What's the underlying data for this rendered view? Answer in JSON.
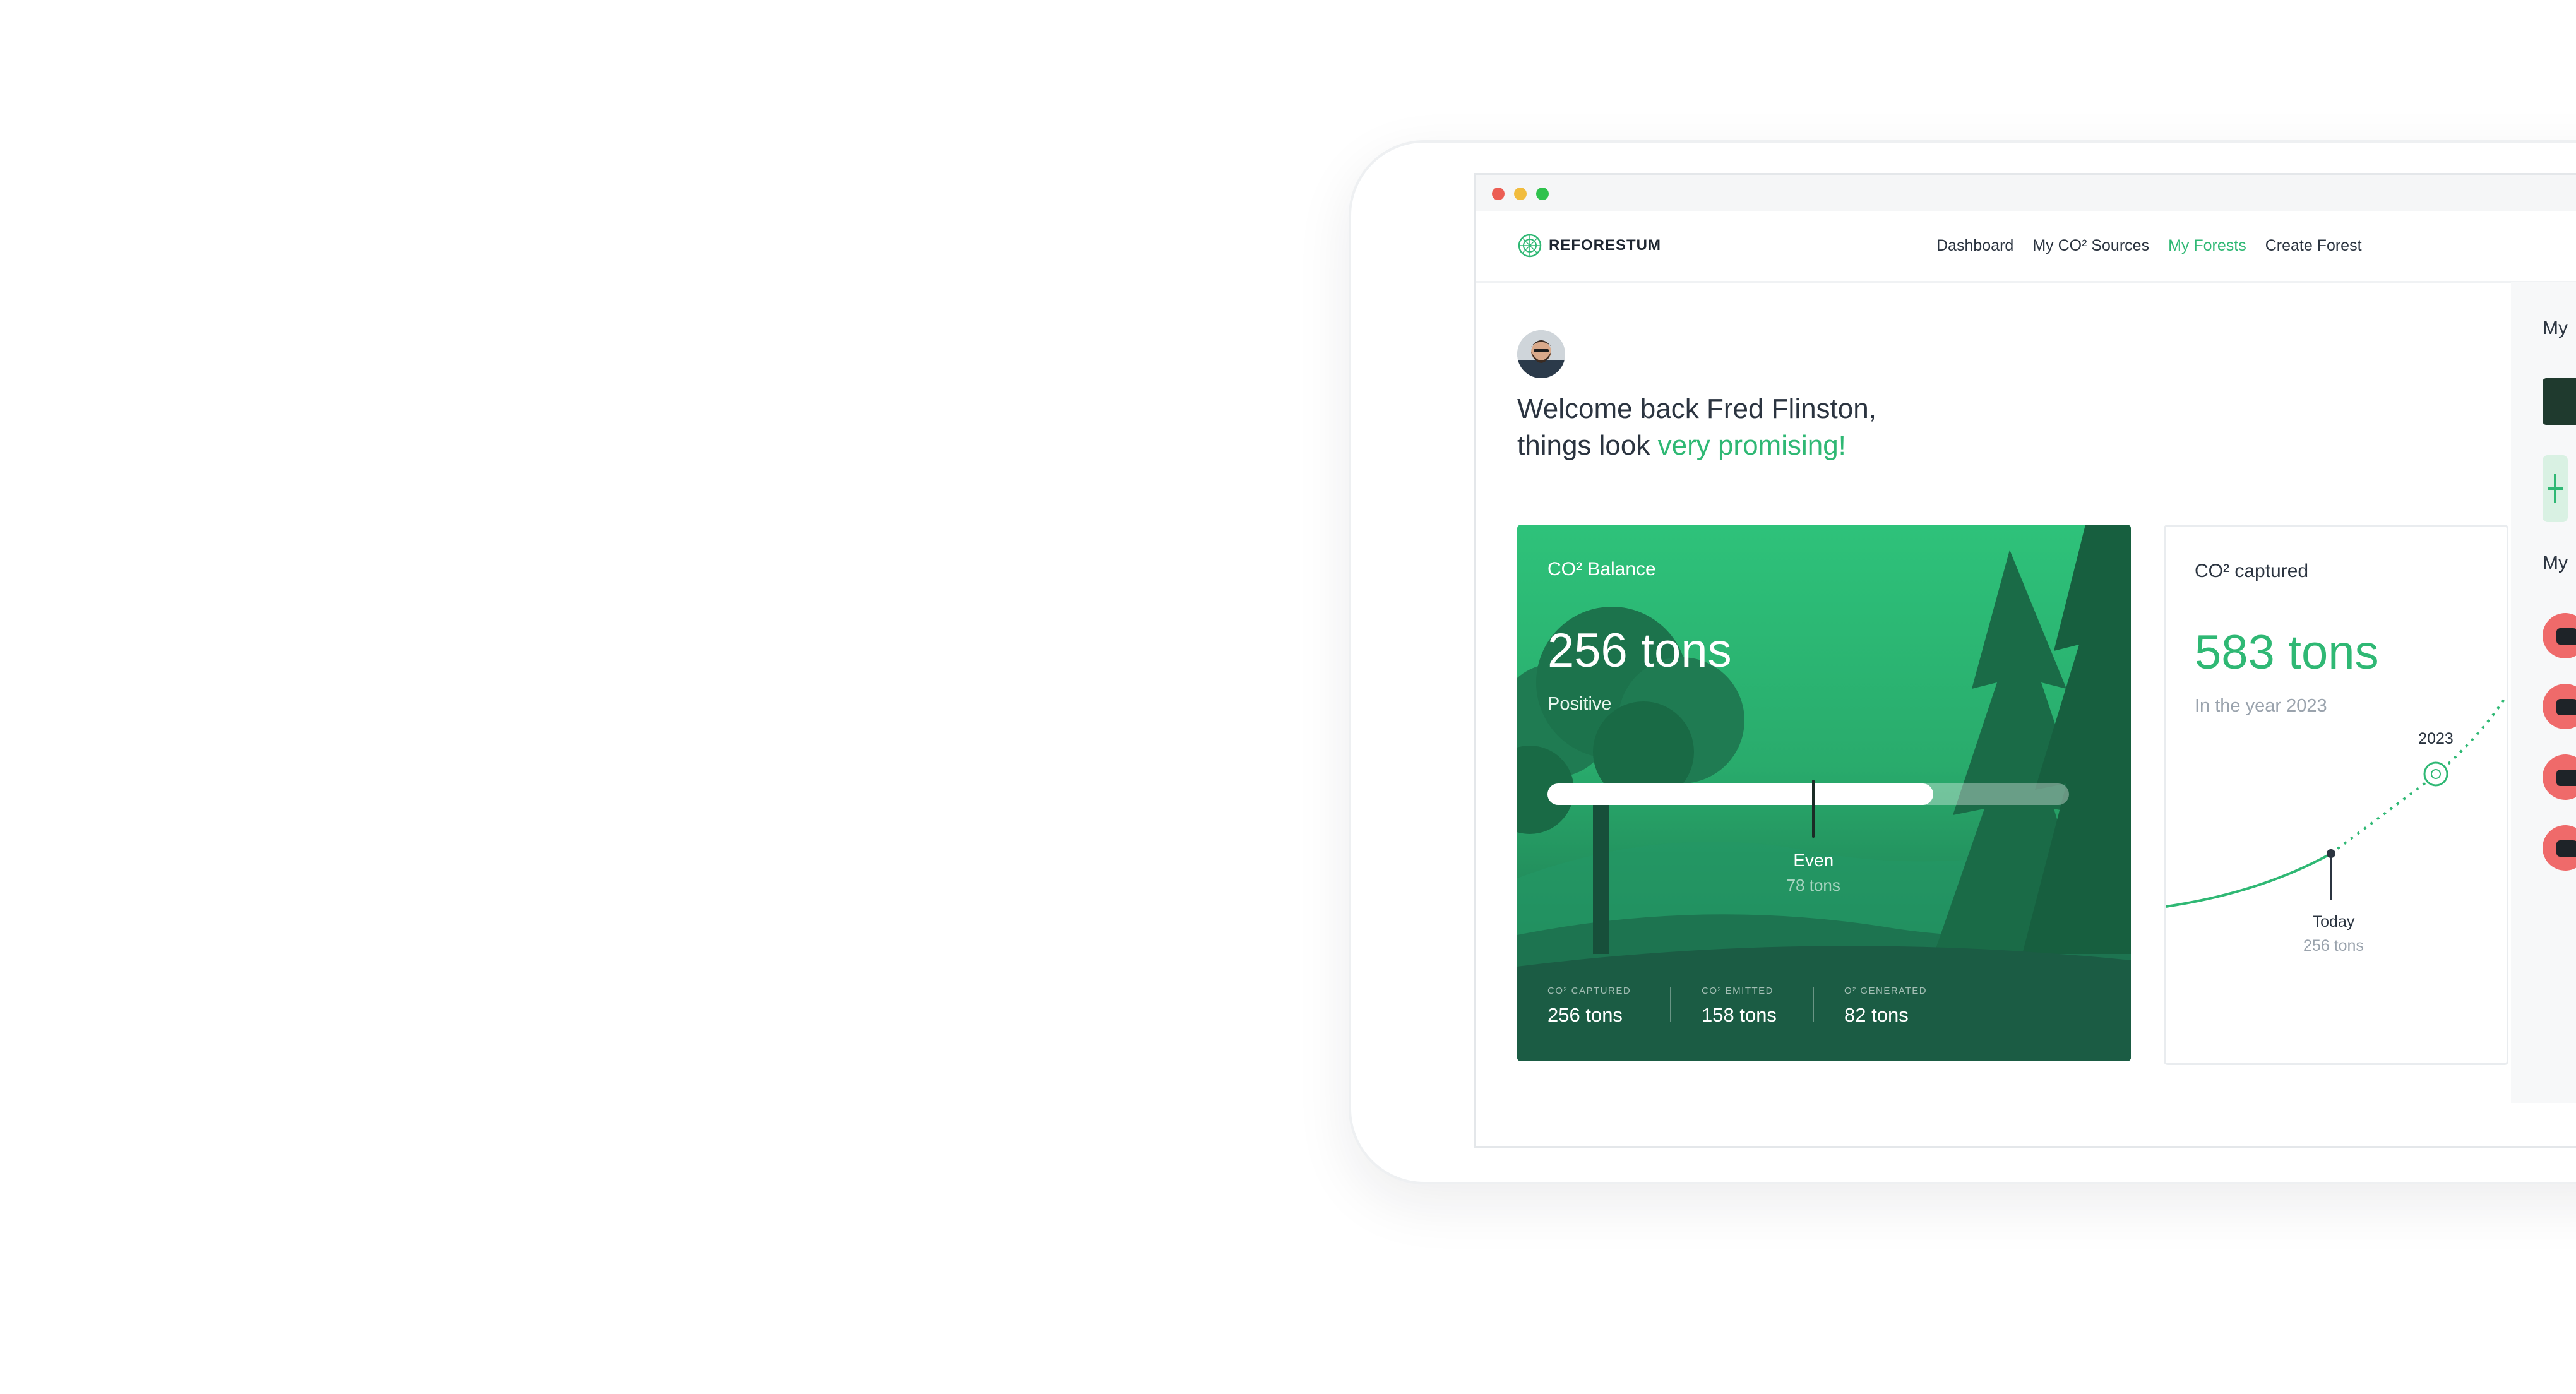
{
  "nav": {
    "brand": "REFORESTUM",
    "links": [
      "Dashboard",
      "My CO² Sources",
      "My Forests",
      "Create Forest"
    ],
    "active": "My Forests"
  },
  "welcome": {
    "line1": "Welcome back Fred Flinston,",
    "line2_prefix": "things look",
    "line2_highlight": "very promising!"
  },
  "balance": {
    "label": "CO² Balance",
    "value": "256 tons",
    "status": "Positive",
    "progress_fraction": 0.74,
    "even_fraction": 0.51,
    "even_label": "Even",
    "even_value": "78 tons",
    "stats": [
      {
        "label": "CO² CAPTURED",
        "value": "256 tons"
      },
      {
        "label": "CO² EMITTED",
        "value": "158 tons"
      },
      {
        "label": "O² GENERATED",
        "value": "82 tons"
      }
    ]
  },
  "captured": {
    "label": "CO² captured",
    "value": "583 tons",
    "subtitle": "In the year 2023",
    "point_year_label": "2023",
    "today_label": "Today",
    "today_value": "256 tons"
  },
  "sidebar": {
    "heading1": "My",
    "heading2": "My",
    "source_count": 4
  },
  "colors": {
    "accent": "#2fb874",
    "source": "#ef6a6a"
  }
}
